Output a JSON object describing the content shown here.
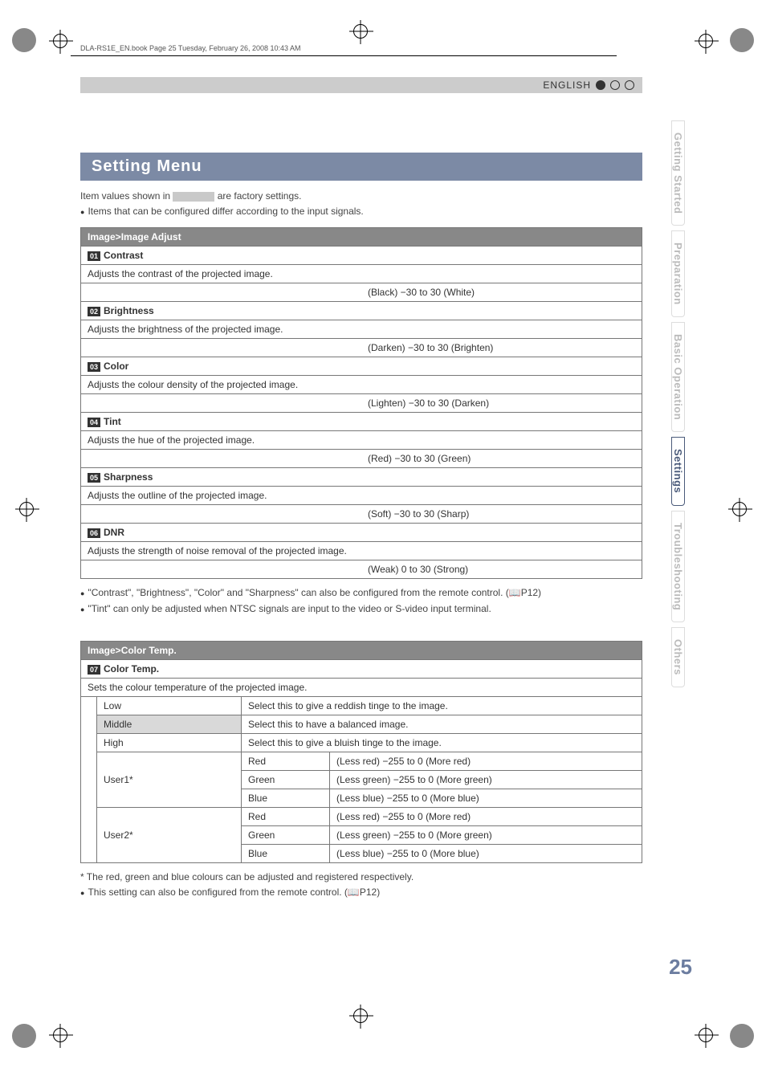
{
  "header": {
    "bookmark": "DLA-RS1E_EN.book  Page 25  Tuesday, February 26, 2008  10:43 AM",
    "language": "ENGLISH"
  },
  "title": "Setting Menu",
  "intro": {
    "line1a": "Item values shown in ",
    "line1b": " are factory settings.",
    "line2": "Items that can be configured differ according to the input signals."
  },
  "imageAdjust": {
    "header": "Image>Image Adjust",
    "items": [
      {
        "num": "01",
        "name": "Contrast",
        "desc": "Adjusts the contrast of the projected image.",
        "range": "(Black) −30 to 30 (White)"
      },
      {
        "num": "02",
        "name": "Brightness",
        "desc": "Adjusts the brightness of the projected image.",
        "range": "(Darken) −30 to 30 (Brighten)"
      },
      {
        "num": "03",
        "name": "Color",
        "desc": "Adjusts the colour density of the projected image.",
        "range": "(Lighten) −30 to 30 (Darken)"
      },
      {
        "num": "04",
        "name": "Tint",
        "desc": "Adjusts the hue of the projected image.",
        "range": "(Red) −30 to 30 (Green)"
      },
      {
        "num": "05",
        "name": "Sharpness",
        "desc": "Adjusts the outline of the projected image.",
        "range": "(Soft) −30 to 30 (Sharp)"
      },
      {
        "num": "06",
        "name": "DNR",
        "desc": "Adjusts the strength of noise removal of the projected image.",
        "range": "(Weak) 0 to 30 (Strong)"
      }
    ],
    "notes": [
      "\"Contrast\", \"Brightness\", \"Color\" and \"Sharpness\" can also be configured from the remote control. (📖P12)",
      "\"Tint\" can only be adjusted when NTSC signals are input to the video or S-video input terminal."
    ]
  },
  "colorTemp": {
    "header": "Image>Color Temp.",
    "num": "07",
    "name": "Color Temp.",
    "desc": "Sets the colour temperature of the projected image.",
    "rows": {
      "low": {
        "label": "Low",
        "desc": "Select this to give a reddish tinge to the image."
      },
      "middle": {
        "label": "Middle",
        "desc": "Select this to have a balanced image."
      },
      "high": {
        "label": "High",
        "desc": "Select this to give a bluish tinge to the image."
      }
    },
    "user1": "User1*",
    "user2": "User2*",
    "channels": {
      "red": {
        "label": "Red",
        "range": "(Less red) −255 to 0 (More red)"
      },
      "green": {
        "label": "Green",
        "range": "(Less green) −255 to 0 (More green)"
      },
      "blue": {
        "label": "Blue",
        "range": "(Less blue) −255 to 0 (More blue)"
      }
    },
    "notes": [
      "* The red, green and blue colours can be adjusted and registered respectively.",
      "This setting can also be configured from the remote control. (📖P12)"
    ]
  },
  "tabs": [
    "Getting Started",
    "Preparation",
    "Basic Operation",
    "Settings",
    "Troubleshooting",
    "Others"
  ],
  "activeTab": 3,
  "pageNumber": "25"
}
